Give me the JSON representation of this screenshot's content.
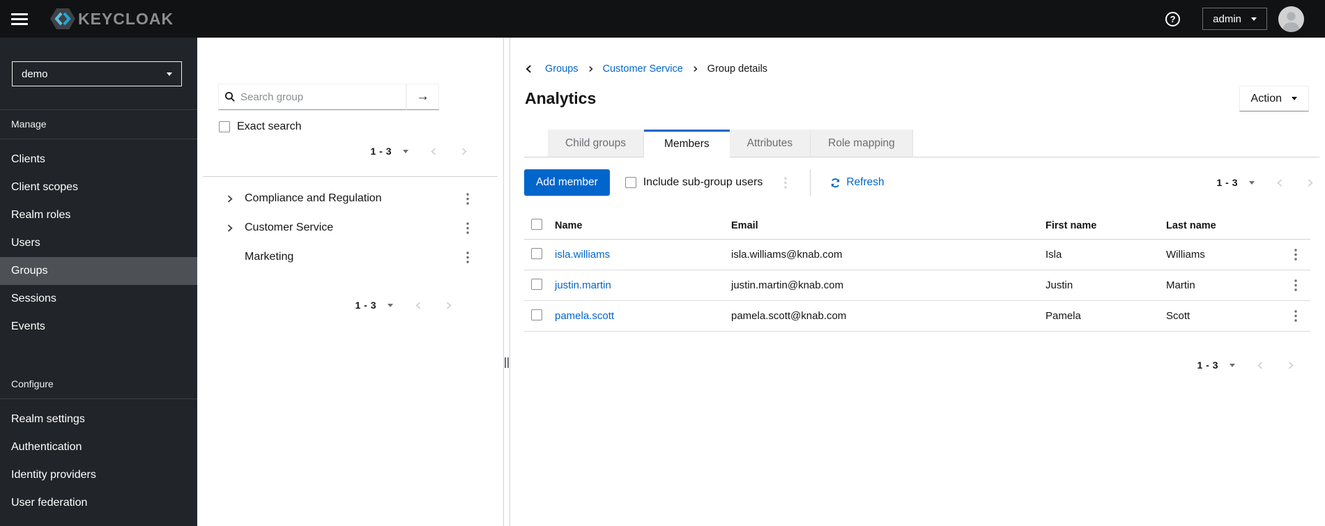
{
  "masthead": {
    "brand_text": "KEYCLOAK",
    "help_glyph": "?",
    "user_menu": {
      "label": "admin"
    }
  },
  "sidebar": {
    "realm_select": {
      "value": "demo"
    },
    "manage_section": {
      "label": "Manage",
      "items": [
        {
          "label": "Clients",
          "selected": false
        },
        {
          "label": "Client scopes",
          "selected": false
        },
        {
          "label": "Realm roles",
          "selected": false
        },
        {
          "label": "Users",
          "selected": false
        },
        {
          "label": "Groups",
          "selected": true
        },
        {
          "label": "Sessions",
          "selected": false
        },
        {
          "label": "Events",
          "selected": false
        }
      ]
    },
    "configure_section": {
      "label": "Configure",
      "items": [
        {
          "label": "Realm settings"
        },
        {
          "label": "Authentication"
        },
        {
          "label": "Identity providers"
        },
        {
          "label": "User federation"
        }
      ]
    }
  },
  "groups_panel": {
    "search": {
      "placeholder": "Search group",
      "submit_glyph": "→"
    },
    "exact_search_label": "Exact search",
    "top_pagination": {
      "range": "1 - 3"
    },
    "tree": [
      {
        "label": "Compliance and Regulation",
        "expandable": true
      },
      {
        "label": "Customer Service",
        "expandable": true
      },
      {
        "label": "Marketing",
        "expandable": false
      }
    ],
    "bottom_pagination": {
      "range": "1 - 3"
    }
  },
  "content": {
    "breadcrumb": {
      "items": [
        {
          "label": "Groups",
          "link": true
        },
        {
          "label": "Customer Service",
          "link": true
        },
        {
          "label": "Group details",
          "link": false
        }
      ]
    },
    "title": "Analytics",
    "action_button": {
      "label": "Action"
    },
    "tabs": [
      {
        "label": "Child groups",
        "active": false
      },
      {
        "label": "Members",
        "active": true
      },
      {
        "label": "Attributes",
        "active": false
      },
      {
        "label": "Role mapping",
        "active": false
      }
    ],
    "members": {
      "add_member_label": "Add member",
      "include_subgroups_label": "Include sub-group users",
      "refresh_label": "Refresh",
      "pagination": {
        "range": "1 - 3"
      },
      "table": {
        "columns": [
          "Name",
          "Email",
          "First name",
          "Last name"
        ],
        "rows": [
          {
            "name": "isla.williams",
            "email": "isla.williams@knab.com",
            "first_name": "Isla",
            "last_name": "Williams"
          },
          {
            "name": "justin.martin",
            "email": "justin.martin@knab.com",
            "first_name": "Justin",
            "last_name": "Martin"
          },
          {
            "name": "pamela.scott",
            "email": "pamela.scott@knab.com",
            "first_name": "Pamela",
            "last_name": "Scott"
          }
        ]
      },
      "bottom_pagination": {
        "range": "1 - 3"
      }
    }
  },
  "colors": {
    "primary_blue": "#0066cc",
    "link_blue": "#0066cc",
    "masthead_bg": "#111214",
    "sidebar_bg": "#212428",
    "sidebar_selected_bg": "#4d5054",
    "tab_inactive_bg": "#f0f0f0",
    "muted_text": "#6a6e73",
    "border": "#d2d2d2"
  }
}
